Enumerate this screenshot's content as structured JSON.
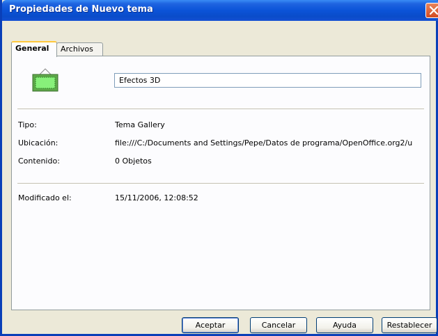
{
  "window": {
    "title": "Propiedades de Nuevo tema"
  },
  "tabs": [
    {
      "label": "General",
      "active": true
    },
    {
      "label": "Archivos",
      "active": false
    }
  ],
  "general": {
    "theme_name": "Efectos 3D",
    "icon": "gallery-theme-icon",
    "fields": [
      {
        "label": "Tipo:",
        "value": "Tema Gallery"
      },
      {
        "label": "Ubicación:",
        "value": "file:///C:/Documents and Settings/Pepe/Datos de programa/OpenOffice.org2/u"
      },
      {
        "label": "Contenido:",
        "value": "0 Objetos"
      }
    ],
    "modified": {
      "label": "Modificado el:",
      "value": "15/11/2006, 12:08:52"
    }
  },
  "buttons": {
    "ok": "Aceptar",
    "cancel": "Cancelar",
    "help": "Ayuda",
    "reset": "Restablecer"
  },
  "colors": {
    "titlebar": "#0b53d8",
    "close": "#d34a21",
    "tab_highlight": "#ffc83c"
  }
}
